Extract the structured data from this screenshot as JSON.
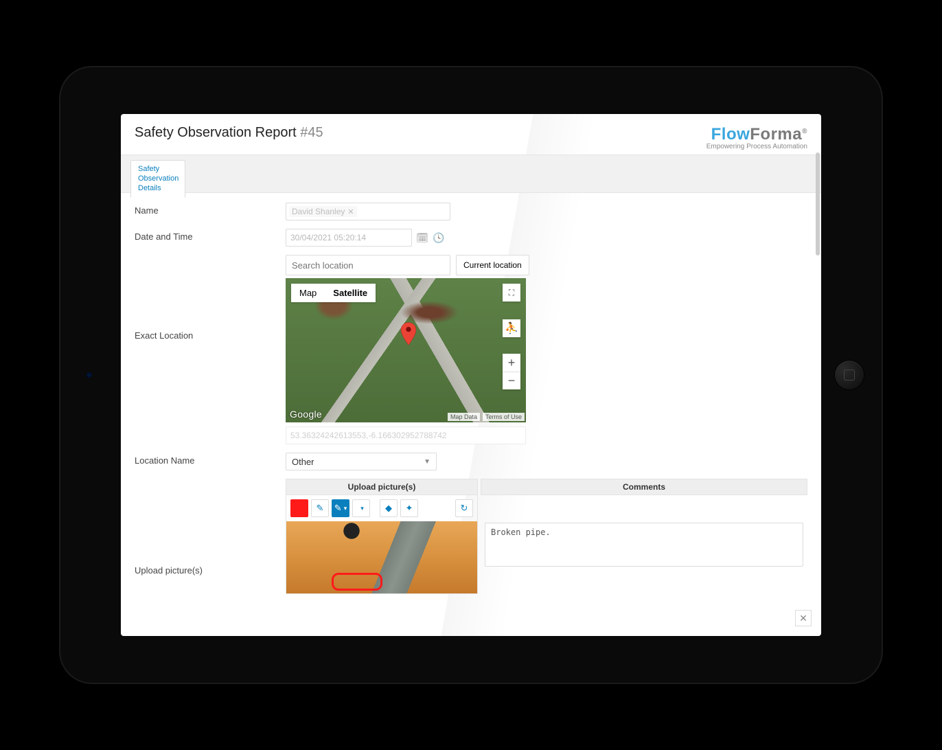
{
  "header": {
    "title": "Safety Observation Report",
    "number": "#45"
  },
  "brand": {
    "part1": "Flow",
    "part2": "Forma",
    "reg": "®",
    "tagline": "Empowering Process Automation"
  },
  "tab": {
    "line1": "Safety",
    "line2": "Observation",
    "line3": "Details"
  },
  "fields": {
    "name_label": "Name",
    "name_value": "David Shanley",
    "datetime_label": "Date and Time",
    "datetime_value": "30/04/2021 05:20:14",
    "exact_loc_label": "Exact Location",
    "search_placeholder": "Search location",
    "current_loc_btn": "Current location",
    "coords_value": "53.36324242613553,-6.166302952788742",
    "loc_name_label": "Location Name",
    "loc_name_value": "Other",
    "upload_label": "Upload picture(s)"
  },
  "map": {
    "map_btn": "Map",
    "sat_btn": "Satellite",
    "google": "Google",
    "mapdata": "Map Data",
    "terms": "Terms of Use",
    "plus": "+",
    "minus": "−",
    "fullscreen": "⛶",
    "pegman": "⛹"
  },
  "cols": {
    "upload_h": "Upload picture(s)",
    "comments_h": "Comments",
    "comment_text": "Broken pipe."
  },
  "toolbar": {
    "picker": "✎",
    "brush": "✎",
    "eraser": "◆",
    "stamp": "✦",
    "reset": "↻"
  }
}
